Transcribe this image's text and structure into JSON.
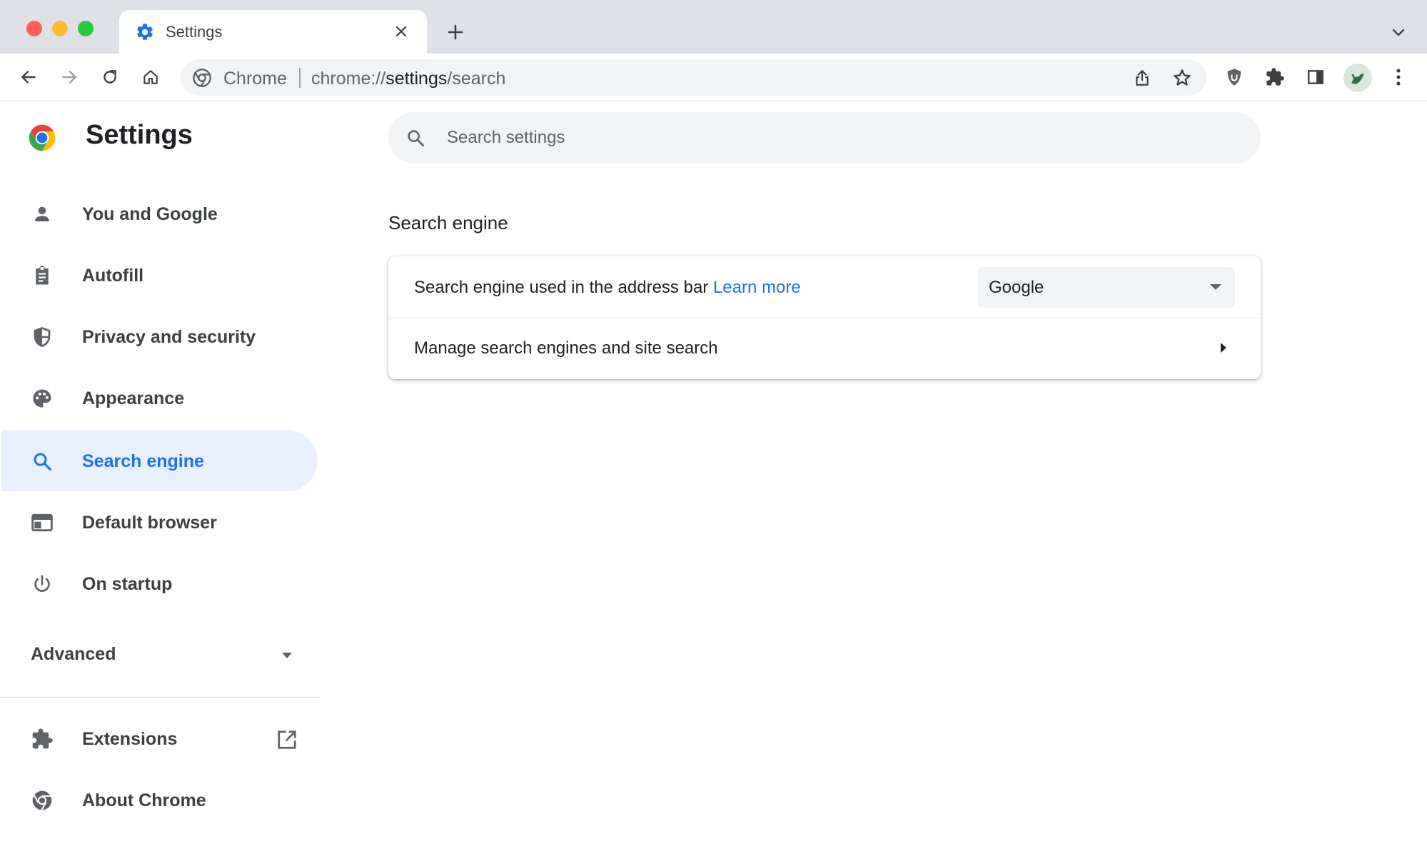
{
  "browser": {
    "tab_title": "Settings",
    "omnibox_chip": "Chrome",
    "url_scheme": "chrome://",
    "url_host": "settings",
    "url_path": "/search"
  },
  "sidebar": {
    "title": "Settings",
    "items": [
      {
        "label": "You and Google",
        "icon": "person-icon"
      },
      {
        "label": "Autofill",
        "icon": "clipboard-icon"
      },
      {
        "label": "Privacy and security",
        "icon": "shield-icon"
      },
      {
        "label": "Appearance",
        "icon": "palette-icon"
      },
      {
        "label": "Search engine",
        "icon": "search-icon",
        "active": true
      },
      {
        "label": "Default browser",
        "icon": "browser-window-icon"
      },
      {
        "label": "On startup",
        "icon": "power-icon"
      }
    ],
    "advanced_label": "Advanced",
    "bottom_items": [
      {
        "label": "Extensions",
        "icon": "puzzle-icon"
      },
      {
        "label": "About Chrome",
        "icon": "chrome-icon"
      }
    ]
  },
  "main": {
    "search_placeholder": "Search settings",
    "section_title": "Search engine",
    "row1_label": "Search engine used in the address bar",
    "row1_link": "Learn more",
    "engine_selected": "Google",
    "row2_label": "Manage search engines and site search"
  },
  "colors": {
    "accent": "#1a73e8",
    "active_bg": "#e8f0fe",
    "tabstrip_bg": "#dee1e6"
  }
}
